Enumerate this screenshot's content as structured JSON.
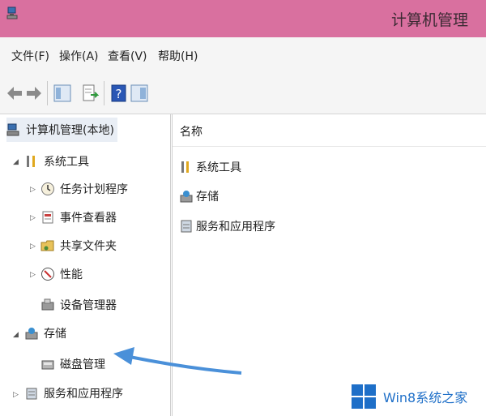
{
  "window": {
    "title": "计算机管理",
    "accent": "#d9709f"
  },
  "menu": {
    "items": [
      "文件(F)",
      "操作(A)",
      "查看(V)",
      "帮助(H)"
    ]
  },
  "toolbar": {
    "icons": [
      "back-arrow-icon",
      "forward-arrow-icon",
      "show-tree-icon",
      "export-list-icon",
      "help-icon",
      "properties-icon"
    ]
  },
  "tree": {
    "root": "计算机管理(本地)",
    "system_tools": "系统工具",
    "task_scheduler": "任务计划程序",
    "event_viewer": "事件查看器",
    "shared_folders": "共享文件夹",
    "performance": "性能",
    "device_manager": "设备管理器",
    "storage": "存储",
    "disk_management": "磁盘管理",
    "services_apps": "服务和应用程序"
  },
  "list": {
    "column_name": "名称",
    "items": [
      "系统工具",
      "存储",
      "服务和应用程序"
    ]
  },
  "watermark": {
    "text": "Win8系统之家"
  }
}
